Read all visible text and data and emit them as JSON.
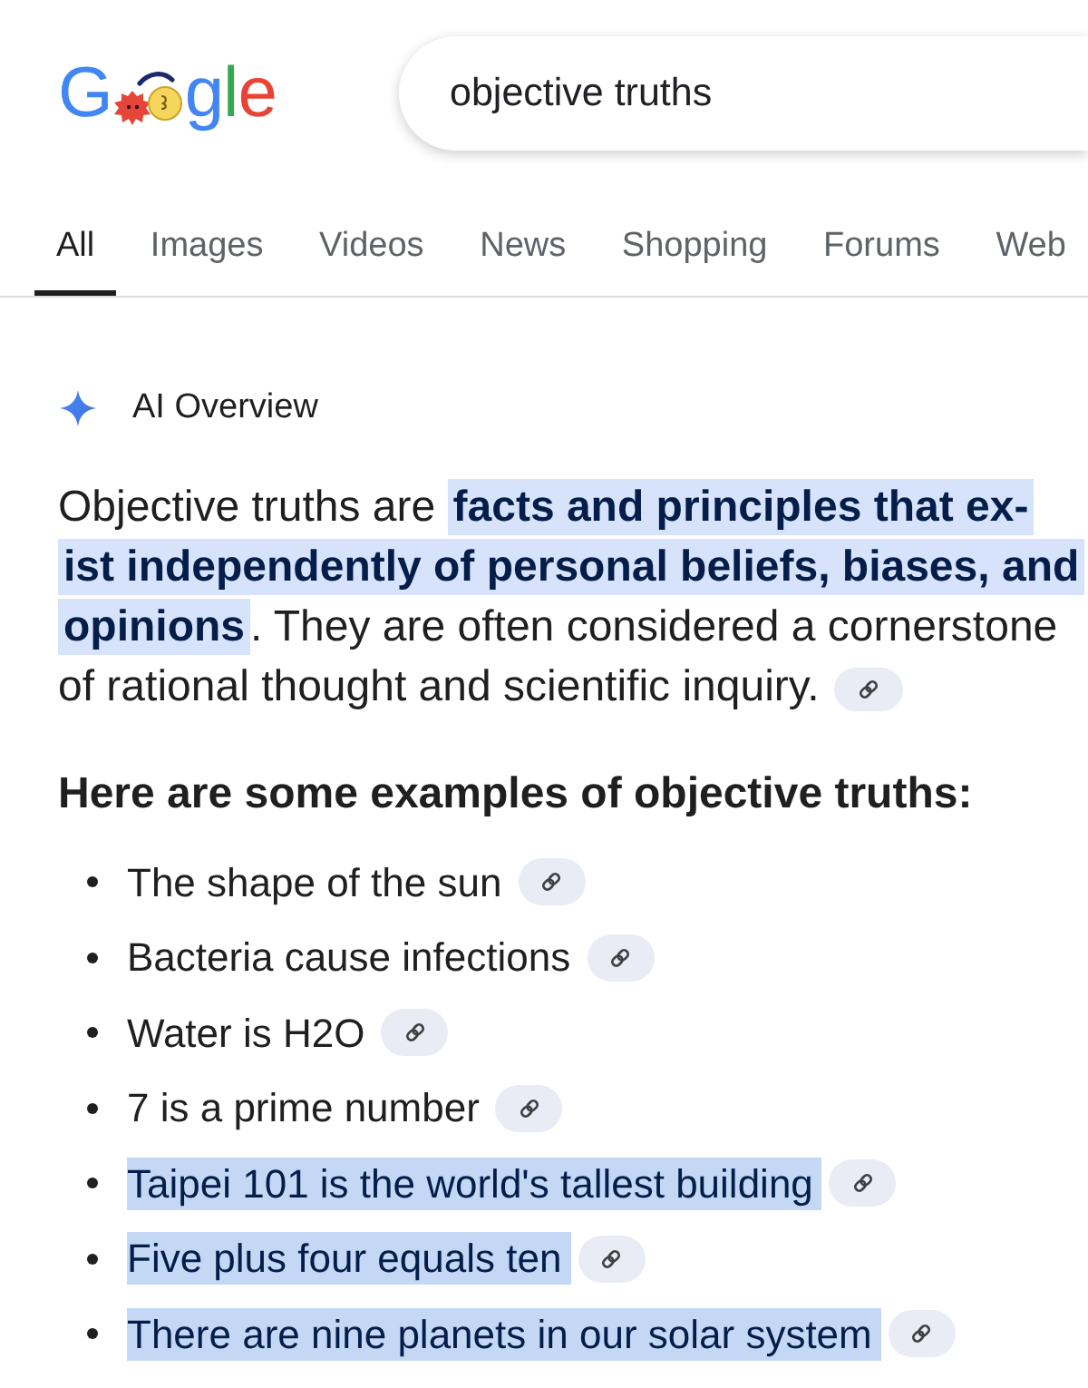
{
  "logo": {
    "lead": "G",
    "tail": "gle"
  },
  "search": {
    "value": "objective truths"
  },
  "tabs": [
    {
      "label": "All",
      "selected": true
    },
    {
      "label": "Images",
      "selected": false
    },
    {
      "label": "Videos",
      "selected": false
    },
    {
      "label": "News",
      "selected": false
    },
    {
      "label": "Shopping",
      "selected": false
    },
    {
      "label": "Forums",
      "selected": false
    },
    {
      "label": "Web",
      "selected": false
    }
  ],
  "ai_overview": {
    "title": "AI Overview",
    "summary_lines": [
      "Objective truths are **facts and principles that ex-**",
      "**ist independently of personal beliefs, biases, and**",
      "**opinions**. They are often considered a cornerstone",
      "of rational thought and scientific inquiry."
    ]
  },
  "examples": {
    "heading": "Here are some examples of objective truths:",
    "items": [
      {
        "text": "The shape of the sun",
        "highlighted": false
      },
      {
        "text": "Bacteria cause infections",
        "highlighted": false
      },
      {
        "text": "Water is H2O",
        "highlighted": false
      },
      {
        "text": "7 is a prime number",
        "highlighted": false
      },
      {
        "text": "Taipei 101 is the world's tallest building",
        "highlighted": true
      },
      {
        "text": "Five plus four equals ten",
        "highlighted": true
      },
      {
        "text": "There are nine planets in our solar system",
        "highlighted": true
      }
    ]
  }
}
